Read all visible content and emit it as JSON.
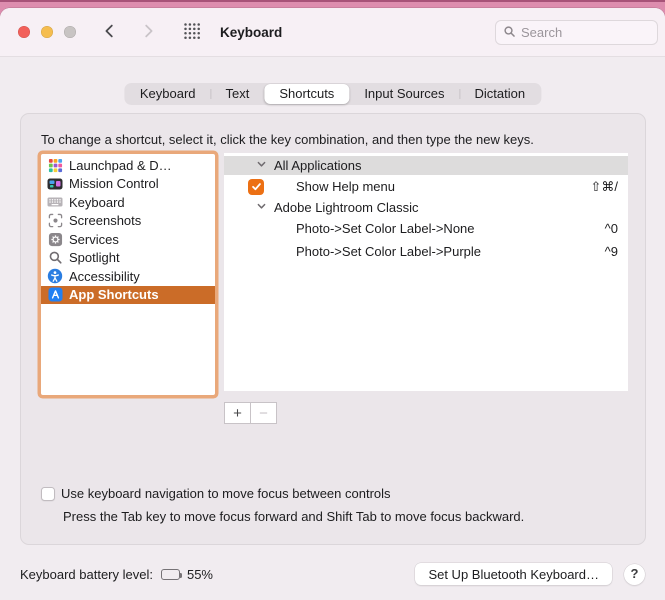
{
  "window": {
    "title": "Keyboard",
    "search": {
      "placeholder": "Search"
    }
  },
  "tabs": [
    {
      "label": "Keyboard",
      "selected": false
    },
    {
      "label": "Text",
      "selected": false
    },
    {
      "label": "Shortcuts",
      "selected": true
    },
    {
      "label": "Input Sources",
      "selected": false
    },
    {
      "label": "Dictation",
      "selected": false
    }
  ],
  "shortcuts_pane": {
    "instruction": "To change a shortcut, select it, click the key combination, and then type the new keys.",
    "sidebar": [
      {
        "label": "Launchpad & D…",
        "icon": "launchpad-icon",
        "selected": false
      },
      {
        "label": "Mission Control",
        "icon": "mission-control-icon",
        "selected": false
      },
      {
        "label": "Keyboard",
        "icon": "keyboard-icon",
        "selected": false
      },
      {
        "label": "Screenshots",
        "icon": "screenshots-icon",
        "selected": false
      },
      {
        "label": "Services",
        "icon": "services-icon",
        "selected": false
      },
      {
        "label": "Spotlight",
        "icon": "spotlight-icon",
        "selected": false
      },
      {
        "label": "Accessibility",
        "icon": "accessibility-icon",
        "selected": false
      },
      {
        "label": "App Shortcuts",
        "icon": "app-shortcuts-icon",
        "selected": true
      }
    ],
    "groups": [
      {
        "header": "All Applications",
        "items": [
          {
            "label": "Show Help menu",
            "checked": true,
            "shortcut": "⇧⌘/"
          }
        ]
      },
      {
        "header": "Adobe Lightroom Classic",
        "items": [
          {
            "label": "Photo->Set Color Label->None",
            "shortcut": "^0"
          },
          {
            "label": "Photo->Set Color Label->Purple",
            "shortcut": "^9"
          }
        ]
      }
    ],
    "add_button": "+",
    "remove_button": "−",
    "keyboard_nav": {
      "checkbox_label": "Use keyboard navigation to move focus between controls",
      "checked": false,
      "subtext": "Press the Tab key to move focus forward and Shift Tab to move focus backward."
    }
  },
  "footer": {
    "battery_label": "Keyboard battery level:",
    "battery_percent": "55%",
    "setup_button_label": "Set Up Bluetooth Keyboard…",
    "help_button_label": "?"
  },
  "colors": {
    "selection_orange": "#cb6c28",
    "checkbox_orange": "#ec7014",
    "focus_ring": "#e9a87a",
    "desktop_pink": "#e693b3"
  }
}
